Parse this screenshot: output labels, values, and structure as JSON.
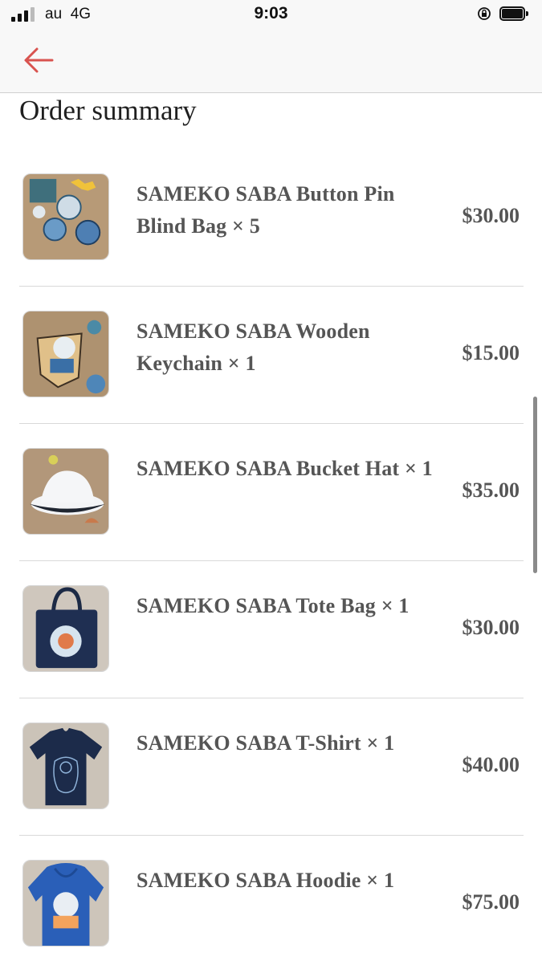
{
  "status_bar": {
    "carrier": "au",
    "network": "4G",
    "time": "9:03"
  },
  "nav": {
    "back_icon": "arrow-left-icon",
    "accent_color": "#d9534f"
  },
  "page": {
    "title": "Order summary"
  },
  "order_items": [
    {
      "name": "SAMEKO SABA Button Pin Blind Bag × 5",
      "price": "$30.00",
      "image": "button-pins-on-sand"
    },
    {
      "name": "SAMEKO SABA Wooden Keychain × 1",
      "price": "$15.00",
      "image": "keychain-on-sand"
    },
    {
      "name": "SAMEKO SABA Bucket Hat × 1",
      "price": "$35.00",
      "image": "bucket-hat-on-sand"
    },
    {
      "name": "SAMEKO SABA Tote Bag × 1",
      "price": "$30.00",
      "image": "navy-tote-bag"
    },
    {
      "name": "SAMEKO SABA T-Shirt × 1",
      "price": "$40.00",
      "image": "navy-t-shirt"
    },
    {
      "name": "SAMEKO SABA Hoodie × 1",
      "price": "$75.00",
      "image": "blue-hoodie"
    }
  ]
}
